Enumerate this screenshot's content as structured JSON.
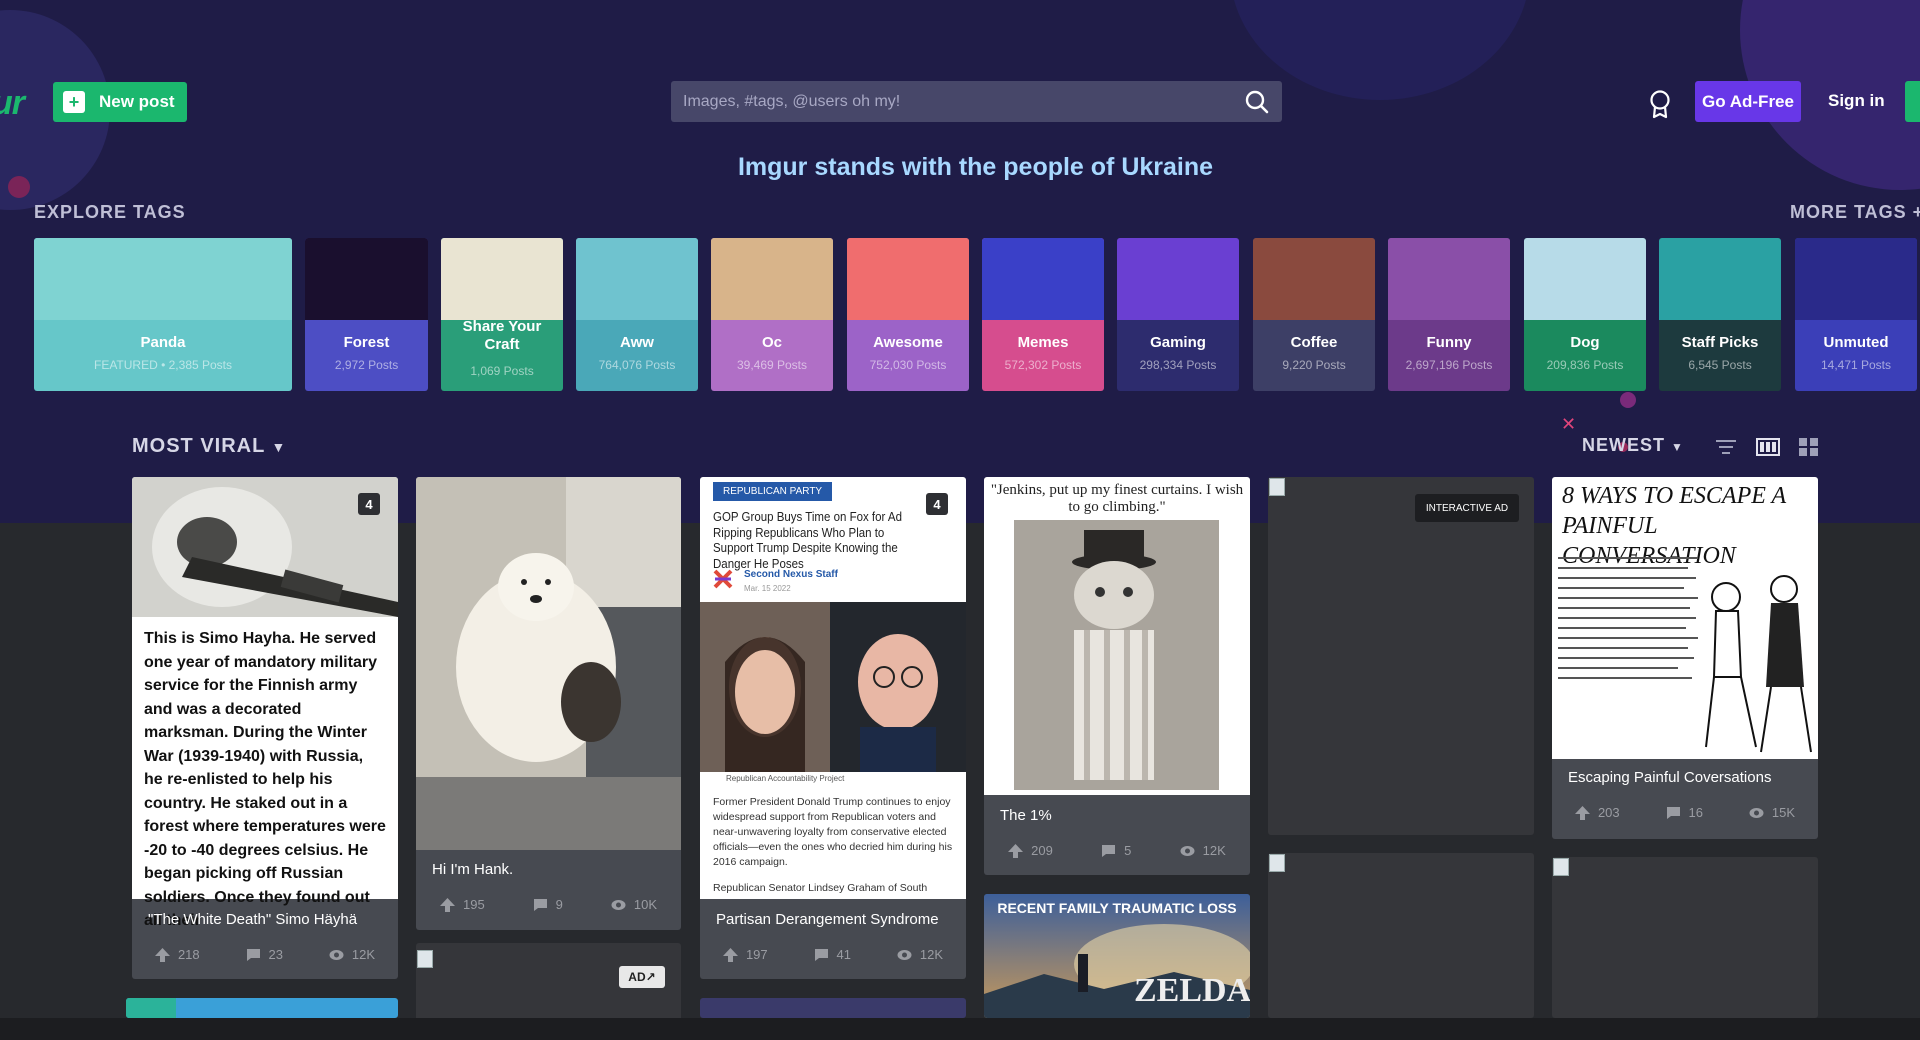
{
  "header": {
    "logo_text": "ur",
    "new_post_label": "New post",
    "search_placeholder": "Images, #tags, @users oh my!",
    "go_ad_free_label": "Go Ad-Free",
    "sign_in_label": "Sign in"
  },
  "banner": "Imgur stands with the people of Ukraine",
  "explore": {
    "label": "EXPLORE TAGS",
    "more_label": "MORE TAGS +",
    "tags": [
      {
        "name": "Panda",
        "posts": "FEATURED • 2,385 Posts",
        "color": "#66c7c9",
        "art": "#7fd3d2"
      },
      {
        "name": "Forest",
        "posts": "2,972 Posts",
        "color": "#4d4ec4",
        "art": "#1a0f2e"
      },
      {
        "name": "Share Your Craft",
        "posts": "1,069 Posts",
        "color": "#2a9e79",
        "art": "#e9e4d2"
      },
      {
        "name": "Aww",
        "posts": "764,076 Posts",
        "color": "#4aa8b8",
        "art": "#6fc3cf"
      },
      {
        "name": "Oc",
        "posts": "39,469 Posts",
        "color": "#b06fc6",
        "art": "#d8b48a"
      },
      {
        "name": "Awesome",
        "posts": "752,030 Posts",
        "color": "#9c63c8",
        "art": "#f06d6e"
      },
      {
        "name": "Memes",
        "posts": "572,302 Posts",
        "color": "#d64d8e",
        "art": "#3a40c8"
      },
      {
        "name": "Gaming",
        "posts": "298,334 Posts",
        "color": "#2d2c6e",
        "art": "#6a3fd2"
      },
      {
        "name": "Coffee",
        "posts": "9,220 Posts",
        "color": "#3d3f66",
        "art": "#8a4a3e"
      },
      {
        "name": "Funny",
        "posts": "2,697,196 Posts",
        "color": "#6c3a8a",
        "art": "#8a4fa8"
      },
      {
        "name": "Dog",
        "posts": "209,836 Posts",
        "color": "#1b8a5e",
        "art": "#b7dbe8"
      },
      {
        "name": "Staff Picks",
        "posts": "6,545 Posts",
        "color": "#1d3a3e",
        "art": "#2aa1a3"
      },
      {
        "name": "Unmuted",
        "posts": "14,471 Posts",
        "color": "#3b3fb8",
        "art": "#2a2a8a"
      }
    ]
  },
  "feed": {
    "sort_label": "MOST VIRAL",
    "order_label": "NEWEST",
    "posts": [
      {
        "title": "\"The White Death\" Simo Häyhä",
        "count": "4",
        "upvotes": "218",
        "comments": "23",
        "views": "12K",
        "caption": "This is Simo Hayha. He served one year of mandatory military service for the Finnish army and was a decorated marksman. During the Winter War (1939-1940) with Russia, he re-enlisted to help his country. He staked out in a forest where temperatures were -20 to -40 degrees celsius. He began picking off Russian soldiers. Once they found out all their"
      },
      {
        "title": "Hi I'm Hank.",
        "upvotes": "195",
        "comments": "9",
        "views": "10K"
      },
      {
        "title": "Partisan Derangement Syndrome",
        "count": "4",
        "upvotes": "197",
        "comments": "41",
        "views": "12K",
        "badge": "REPUBLICAN PARTY",
        "headline": "GOP Group Buys Time on Fox for Ad Ripping Republicans Who Plan to Support Trump Despite Knowing the Danger He Poses",
        "author": "Second Nexus Staff",
        "date": "Mar. 15 2022",
        "photo_credit": "Republican Accountability Project",
        "body": "Former President Donald Trump continues to enjoy widespread support from Republican voters and near-unwavering loyalty from conservative elected officials—even the ones who decried him during his 2016 campaign.",
        "body2": "Republican Senator Lindsey Graham of South"
      },
      {
        "title": "The 1%",
        "upvotes": "209",
        "comments": "5",
        "views": "12K",
        "quote": "\"Jenkins, put up my finest curtains. I wish to go climbing.\""
      },
      {
        "title": "Escaping Painful Coversations",
        "upvotes": "203",
        "comments": "16",
        "views": "15K",
        "comic_title": "8 WAYS TO ESCAPE A PAINFUL CONVERSATION"
      }
    ],
    "zelda_banner": "RECENT FAMILY TRAUMATIC LOSS",
    "zelda_logo": "ZELDA",
    "interactive_ad_label": "INTERACTIVE AD",
    "ad_label": "AD↗"
  }
}
